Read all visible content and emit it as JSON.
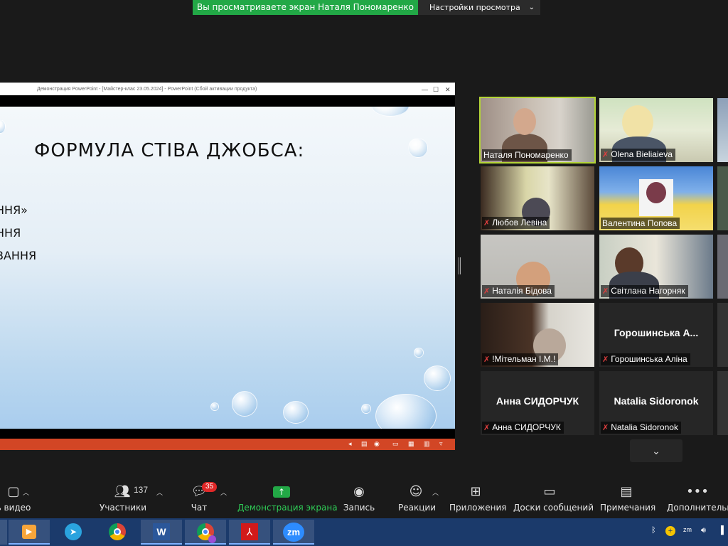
{
  "banner": {
    "viewing_text": "Вы просматриваете экран Наталя Пономаренко",
    "settings_label": "Настройки просмотра",
    "settings_chevron": "⌄"
  },
  "shared": {
    "window_title": "Демонстрация PowerPoint - [Майстер-клас 23.05.2024] - PowerPoint (Сбой активации продукта)",
    "slide_title": "ФОРМУЛА СТІВА ДЖОБСА:",
    "bullets": [
      "ННЯ»",
      "ННЯ",
      "ВАННЯ"
    ]
  },
  "gallery": {
    "tiles": [
      {
        "name": "Наталя Пономаренко",
        "muted": false,
        "big": ""
      },
      {
        "name": "Olena Bieliaieva",
        "muted": true,
        "big": ""
      },
      {
        "name": "Любов Левіна",
        "muted": true,
        "big": ""
      },
      {
        "name": "Валентина Попова",
        "muted": false,
        "big": ""
      },
      {
        "name": "Наталія Бідова",
        "muted": true,
        "big": ""
      },
      {
        "name": "Світлана Нагорняк",
        "muted": true,
        "big": ""
      },
      {
        "name": "!Мітельман І.М.!",
        "muted": true,
        "big": ""
      },
      {
        "name": "Горошинська Аліна",
        "muted": true,
        "big": "Горошинська А..."
      },
      {
        "name": "Анна СИДОРЧУК",
        "muted": true,
        "big": "Анна СИДОРЧУК"
      },
      {
        "name": "Natalia Sidoronok",
        "muted": true,
        "big": "Natalia Sidoronok"
      }
    ],
    "down_arrow": "⌄"
  },
  "toolbar": {
    "video_label": "ь видео",
    "participants_label": "Участники",
    "participants_count": "137",
    "chat_label": "Чат",
    "chat_badge": "35",
    "share_label": "Демонстрация экрана",
    "record_label": "Запись",
    "reactions_label": "Реакции",
    "apps_label": "Приложения",
    "whiteboards_label": "Доски сообщений",
    "notes_label": "Примечания",
    "more_label": "Дополнительно"
  },
  "taskbar": {
    "apps": [
      "media-player",
      "telegram",
      "chrome",
      "word",
      "chrome-profile",
      "acrobat",
      "zoom"
    ],
    "zoom_label": "zm",
    "word_label": "W"
  },
  "colors": {
    "zoom_green": "#22a846",
    "active_speaker": "#b3d437",
    "muted_red": "#e03e3e",
    "ppt_orange": "#d24625",
    "taskbar_blue": "#1b3a6b"
  }
}
